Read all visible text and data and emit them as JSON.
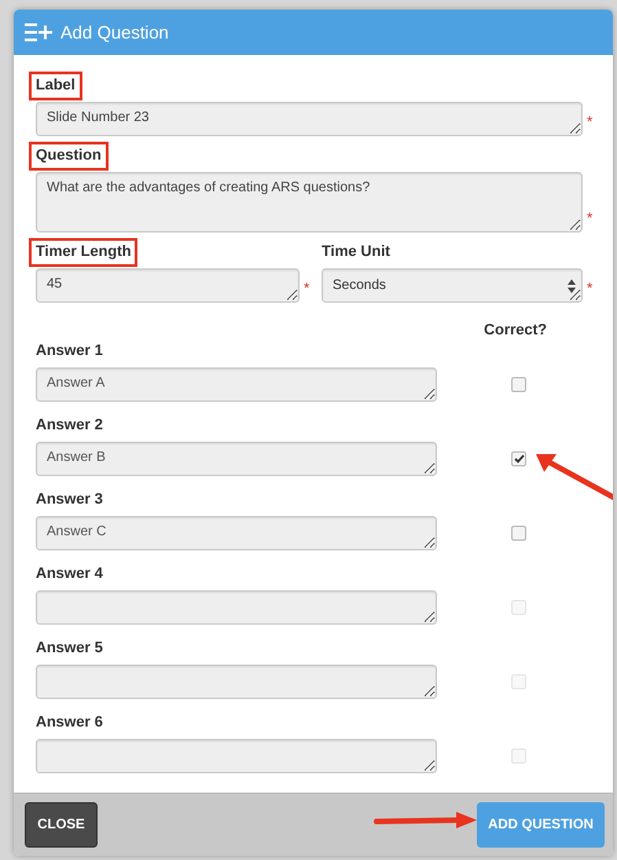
{
  "dialog": {
    "title": "Add Question"
  },
  "fields": [
    {
      "kind": "text",
      "label": "Label",
      "highlighted": true,
      "value": "Slide Number 23",
      "required_mark": "*"
    },
    {
      "kind": "textarea",
      "label": "Question",
      "highlighted": true,
      "value": "What are the advantages of creating ARS questions?",
      "required_mark": "*"
    }
  ],
  "timer": [
    {
      "kind": "text",
      "label": "Timer Length",
      "highlighted": true,
      "value": "45",
      "required_mark": "*"
    },
    {
      "kind": "select",
      "label": "Time Unit",
      "highlighted": false,
      "value": "Seconds",
      "required_mark": "*"
    }
  ],
  "correct_header": "Correct?",
  "answers": [
    {
      "label": "Answer 1",
      "value": "Answer A",
      "checked": false,
      "disabled": false,
      "pointed": false
    },
    {
      "label": "Answer 2",
      "value": "Answer B",
      "checked": true,
      "disabled": false,
      "pointed": true
    },
    {
      "label": "Answer 3",
      "value": "Answer C",
      "checked": false,
      "disabled": false,
      "pointed": false
    },
    {
      "label": "Answer 4",
      "checked": false,
      "disabled": true,
      "pointed": false
    },
    {
      "label": "Answer 5",
      "checked": false,
      "disabled": true,
      "pointed": false
    },
    {
      "label": "Answer 6",
      "checked": false,
      "disabled": true,
      "pointed": false
    }
  ],
  "buttons": [
    {
      "kind": "secondary",
      "label": "CLOSE",
      "pointed": false
    },
    {
      "kind": "primary",
      "label": "ADD QUESTION",
      "pointed": true
    }
  ]
}
